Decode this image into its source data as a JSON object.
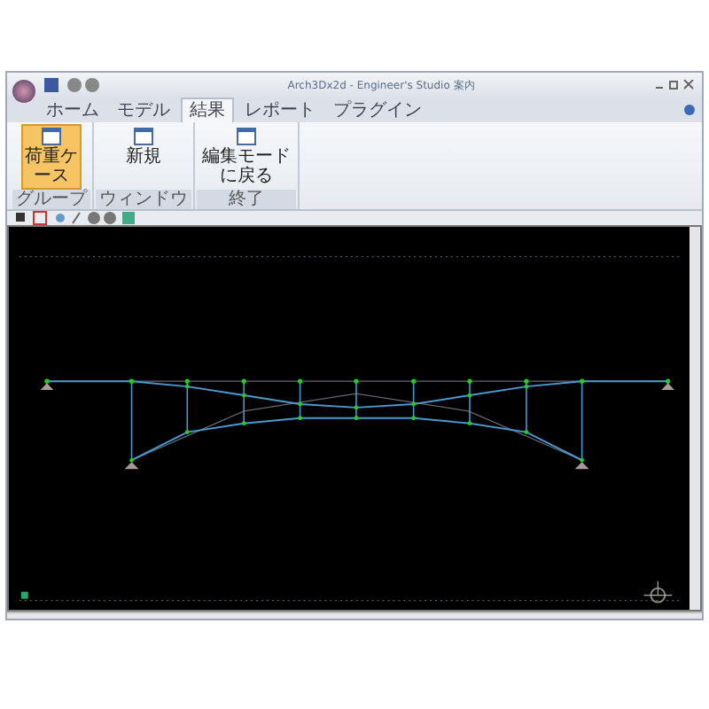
{
  "window": {
    "title": "Arch3Dx2d - Engineer's Studio 案内"
  },
  "tabs": [
    {
      "label": "ホーム",
      "selected": false
    },
    {
      "label": "モデル",
      "selected": false
    },
    {
      "label": "結果",
      "selected": true
    },
    {
      "label": "レポート",
      "selected": false
    },
    {
      "label": "プラグイン",
      "selected": false
    }
  ],
  "ribbon_groups": [
    {
      "label": "グループ",
      "buttons": [
        {
          "label": "荷重ケース",
          "selected": true
        }
      ]
    },
    {
      "label": "ウィンドウ",
      "buttons": [
        {
          "label": "新規",
          "selected": false
        }
      ]
    },
    {
      "label": "終了",
      "buttons": [
        {
          "label": "編集モードに戻る",
          "selected": false
        }
      ]
    }
  ]
}
